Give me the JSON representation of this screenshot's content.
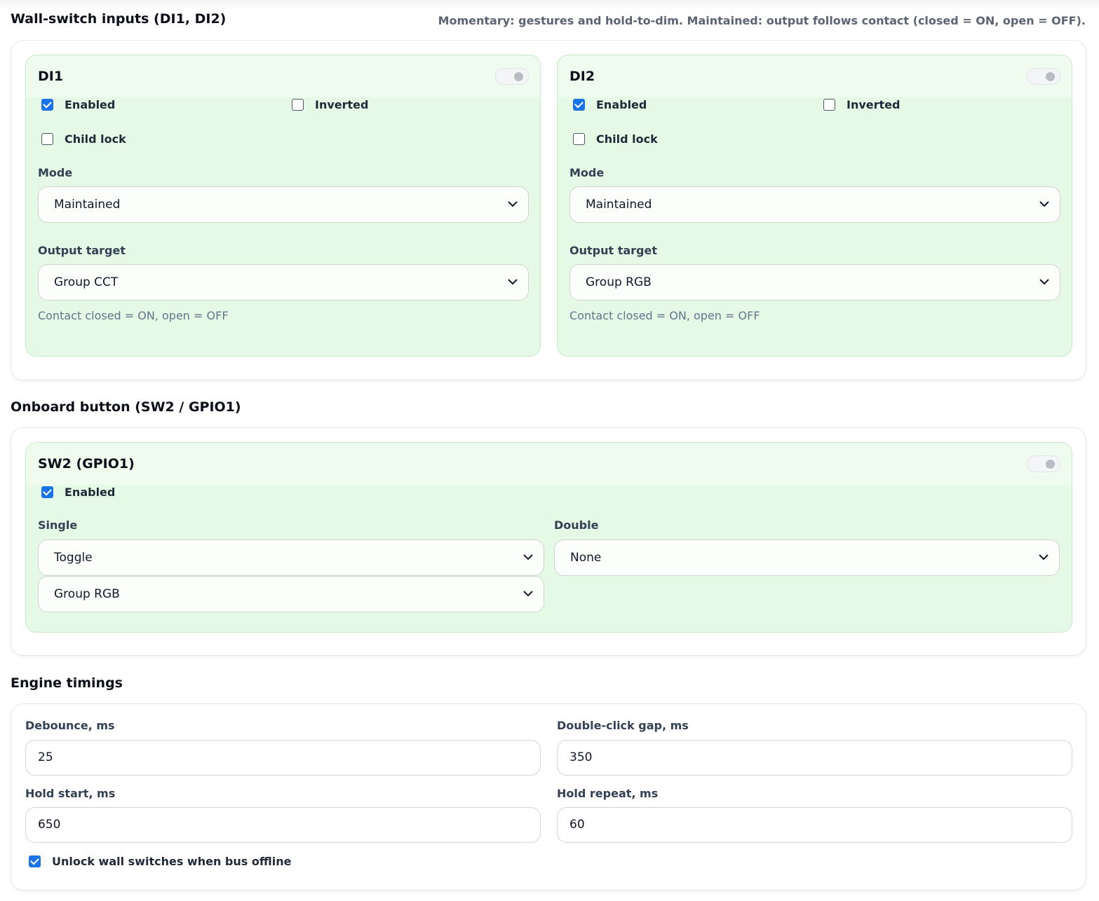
{
  "wall_switch": {
    "title": "Wall-switch inputs (DI1, DI2)",
    "hint": "Momentary: gestures and hold-to-dim. Maintained: output follows contact (closed = ON, open = OFF).",
    "panels": [
      {
        "title": "DI1",
        "enabled_label": "Enabled",
        "enabled": true,
        "inverted_label": "Inverted",
        "inverted": false,
        "child_lock_label": "Child lock",
        "child_lock": false,
        "mode_label": "Mode",
        "mode_value": "Maintained",
        "target_label": "Output target",
        "target_value": "Group CCT",
        "helper": "Contact closed = ON, open = OFF"
      },
      {
        "title": "DI2",
        "enabled_label": "Enabled",
        "enabled": true,
        "inverted_label": "Inverted",
        "inverted": false,
        "child_lock_label": "Child lock",
        "child_lock": false,
        "mode_label": "Mode",
        "mode_value": "Maintained",
        "target_label": "Output target",
        "target_value": "Group RGB",
        "helper": "Contact closed = ON, open = OFF"
      }
    ]
  },
  "onboard": {
    "title": "Onboard button (SW2 / GPIO1)",
    "panel_title": "SW2 (GPIO1)",
    "enabled_label": "Enabled",
    "enabled": true,
    "single_label": "Single",
    "single_action": "Toggle",
    "single_target": "Group RGB",
    "double_label": "Double",
    "double_action": "None"
  },
  "engine": {
    "title": "Engine timings",
    "debounce_label": "Debounce, ms",
    "debounce_value": "25",
    "double_gap_label": "Double-click gap, ms",
    "double_gap_value": "350",
    "hold_start_label": "Hold start, ms",
    "hold_start_value": "650",
    "hold_repeat_label": "Hold repeat, ms",
    "hold_repeat_value": "60",
    "unlock_label": "Unlock wall switches when bus offline",
    "unlock": true
  },
  "colors": {
    "panel_bg": "#e6f9e6",
    "checkbox_accent": "#1a73e8"
  }
}
